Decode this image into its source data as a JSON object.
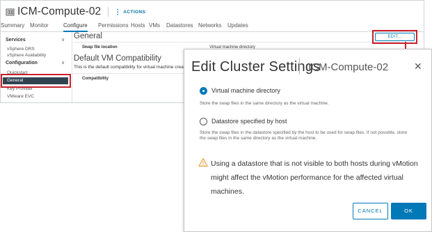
{
  "object_header": {
    "title": "ICM-Compute-02",
    "actions_label": "ACTIONS"
  },
  "tabs": [
    "Summary",
    "Monitor",
    "Configure",
    "Permissions",
    "Hosts",
    "VMs",
    "Datastores",
    "Networks",
    "Updates"
  ],
  "active_tab": "Configure",
  "sidebar": {
    "groups": [
      {
        "label": "Services",
        "items": [
          "vSphere DRS",
          "vSphere Availability"
        ]
      },
      {
        "label": "Configuration",
        "items": [
          "Quickstart",
          "General",
          "Key Provider",
          "VMware EVC"
        ]
      }
    ],
    "selected_item": "General"
  },
  "content": {
    "section_title": "General",
    "edit_button": "EDIT...",
    "swap_label": "Swap file location",
    "swap_value": "Virtual machine directory",
    "compat_title": "Default VM Compatibility",
    "compat_desc": "This is the default compatibility for virtual machine creat",
    "compat_label": "Compatibility"
  },
  "dialog": {
    "title": "Edit Cluster Settings",
    "subtitle": "ICM-Compute-02",
    "options": [
      {
        "label": "Virtual machine directory",
        "description": "Store the swap files in the same directory as the virtual machine.",
        "selected": true
      },
      {
        "label": "Datastore specified by host",
        "description": "Store the swap files in the datastore specified by the host to be used for swap files. If not possible, store the swap files in the same directory as the virtual machine.",
        "selected": false
      }
    ],
    "warning": "Using a datastore that is not visible to both hosts during vMotion might affect the vMotion performance for the affected virtual machines.",
    "cancel_label": "CANCEL",
    "ok_label": "OK"
  },
  "colors": {
    "accent": "#0079b8",
    "highlight": "#c8202a",
    "selected_nav": "#314351",
    "warning": "#e8a33d"
  }
}
